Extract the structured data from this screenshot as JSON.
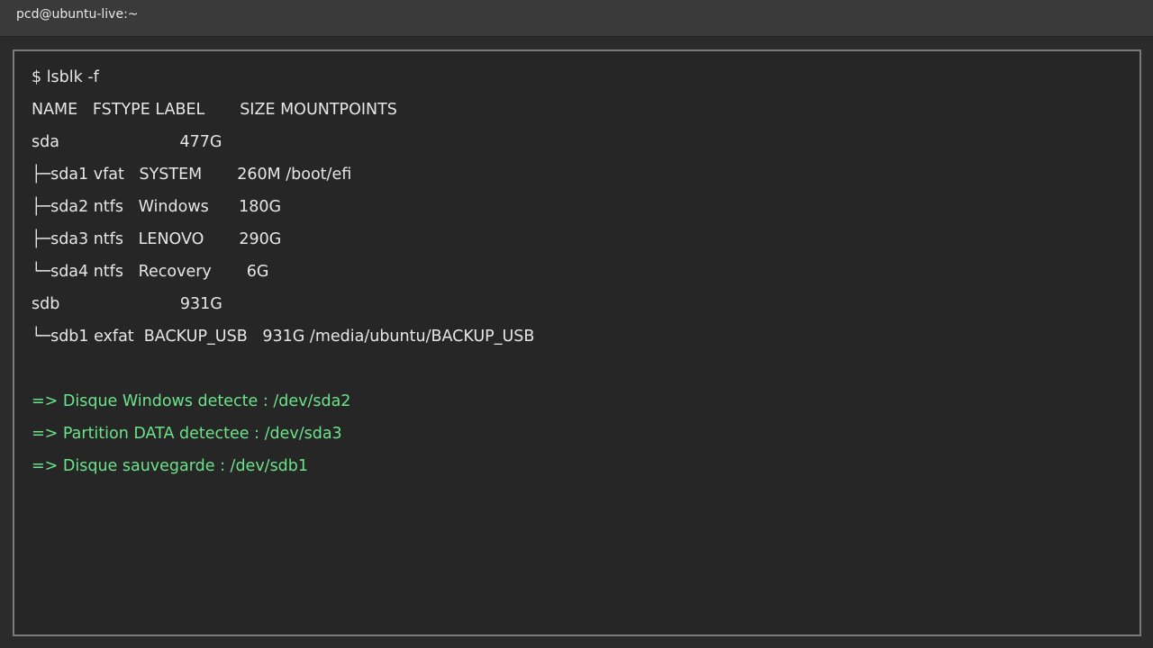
{
  "window": {
    "title": "pcd@ubuntu-live:~"
  },
  "terminal": {
    "prompt_line": "$ lsblk -f",
    "lsblk_output": [
      "NAME   FSTYPE LABEL       SIZE MOUNTPOINTS",
      "sda                        477G",
      "├─sda1 vfat   SYSTEM       260M /boot/efi",
      "├─sda2 ntfs   Windows      180G",
      "├─sda3 ntfs   LENOVO       290G",
      "└─sda4 ntfs   Recovery       6G",
      "sdb                        931G",
      "└─sdb1 exfat  BACKUP_USB   931G /media/ubuntu/BACKUP_USB"
    ],
    "detections": [
      "=> Disque Windows detecte : /dev/sda2",
      "=> Partition DATA detectee : /dev/sda3",
      "=> Disque sauvegarde : /dev/sdb1"
    ],
    "colors": {
      "background": "#262626",
      "text": "#e6e6e6",
      "highlight": "#6be38a"
    }
  }
}
